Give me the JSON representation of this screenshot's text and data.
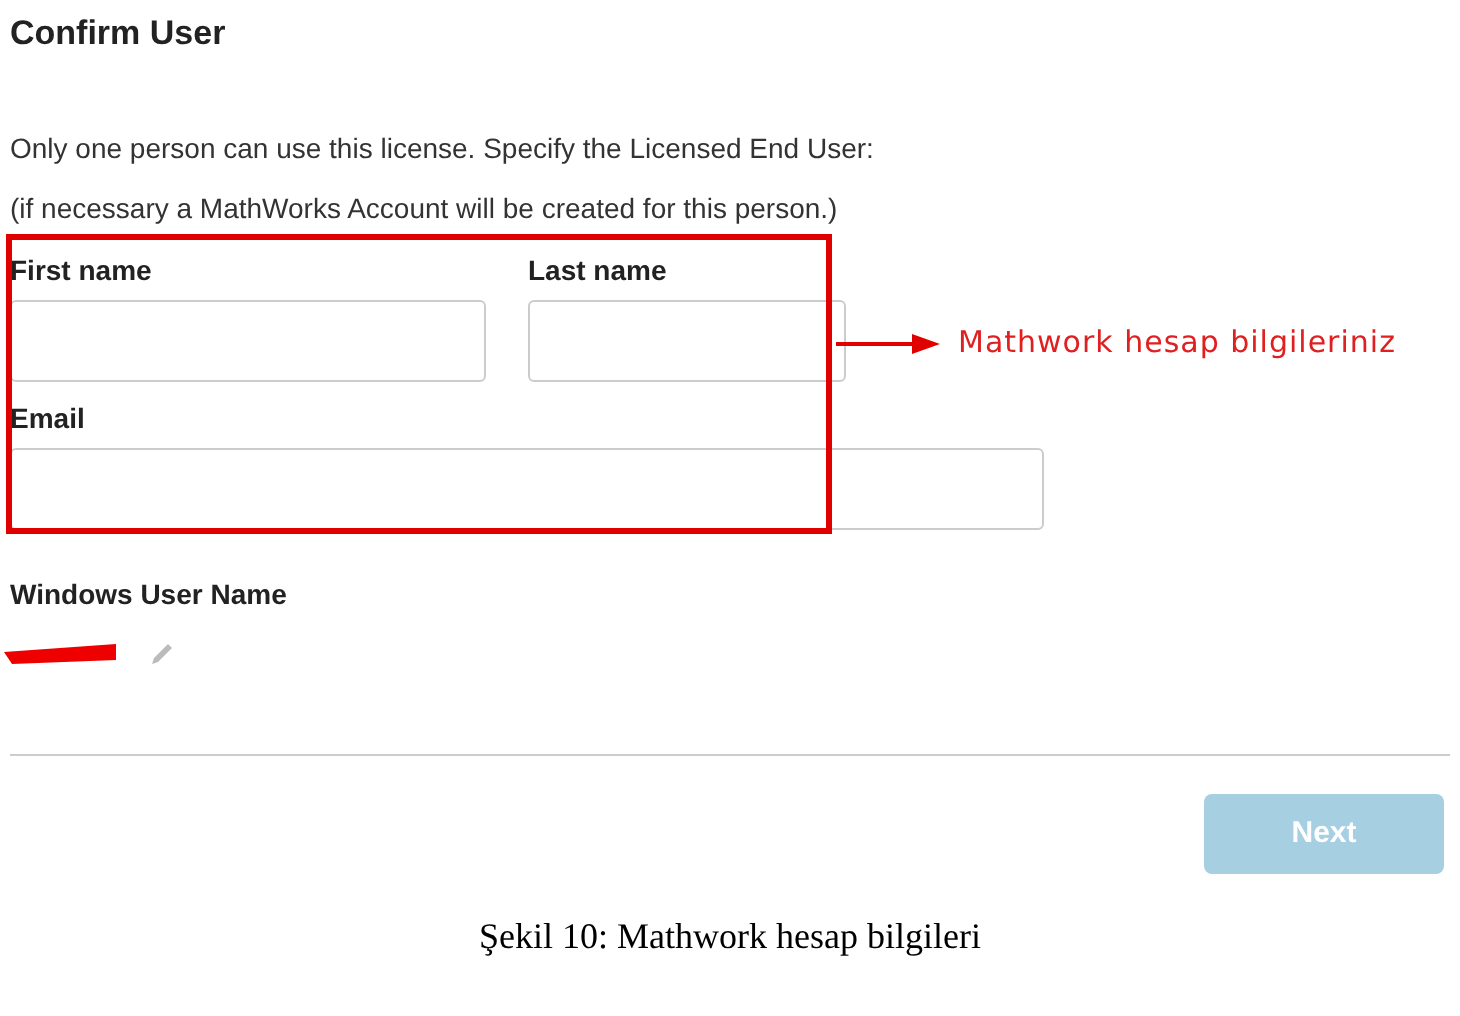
{
  "title": "Confirm User",
  "intro": [
    "Only one person can use this license. Specify the Licensed End User:",
    "(if necessary a MathWorks Account will be created for this person.)"
  ],
  "fields": {
    "first_name": {
      "label": "First name"
    },
    "last_name": {
      "label": "Last name"
    },
    "email": {
      "label": "Email"
    }
  },
  "annotation": {
    "text": "Mathwork hesap bilgileriniz"
  },
  "windows_user": {
    "label": "Windows User Name"
  },
  "next_button": {
    "label": "Next",
    "disabled": true
  },
  "caption": "Şekil 10: Mathwork hesap bilgileri"
}
